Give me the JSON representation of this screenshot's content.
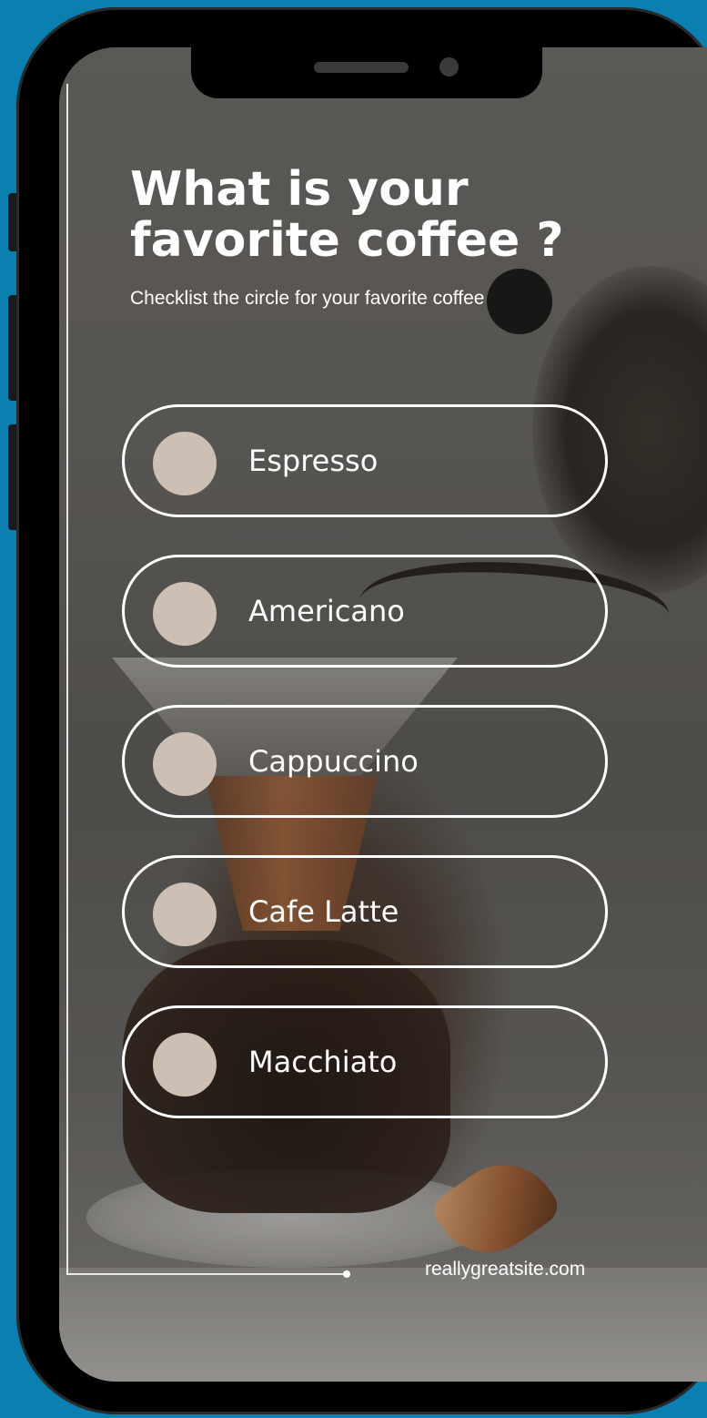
{
  "survey": {
    "title_line1": "What is your",
    "title_line2": "favorite coffee ?",
    "subtitle": "Checklist the circle for your favorite coffee",
    "options": [
      {
        "label": "Espresso"
      },
      {
        "label": "Americano"
      },
      {
        "label": "Cappuccino"
      },
      {
        "label": "Cafe Latte"
      },
      {
        "label": "Macchiato"
      }
    ],
    "footer_site": "reallygreatsite.com"
  },
  "colors": {
    "background": "#0a7fb0",
    "radio_fill": "#cdbfb3",
    "text": "#ffffff"
  }
}
